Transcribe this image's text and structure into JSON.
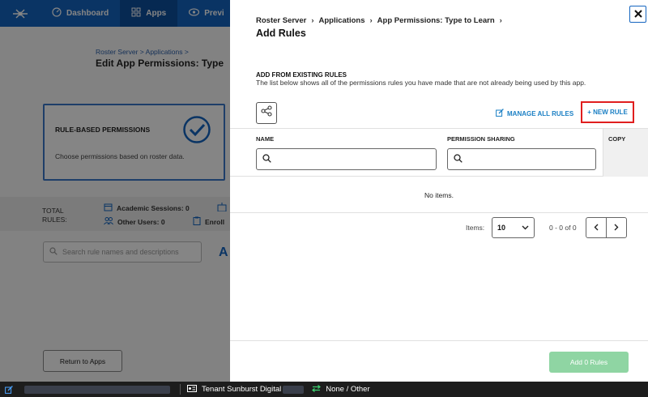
{
  "background": {
    "nav": [
      {
        "label": "Dashboard",
        "icon": "dashboard-icon"
      },
      {
        "label": "Apps",
        "icon": "grid-icon"
      },
      {
        "label": "Previ",
        "icon": "eye-icon"
      }
    ],
    "breadcrumb": [
      "Roster Server",
      "Applications"
    ],
    "title": "Edit App Permissions: Type",
    "card": {
      "title": "RULE-BASED PERMISSIONS",
      "description": "Choose permissions based on roster data."
    },
    "stats": {
      "total_label": "TOTAL RULES:",
      "academic_sessions": "Academic Sessions: 0",
      "other_users": "Other Users: 0",
      "enroll": "Enroll"
    },
    "search_placeholder": "Search rule names and descriptions",
    "big_letter": "A",
    "return_button": "Return to Apps"
  },
  "statusbar": {
    "tenant": "Tenant Sunburst Digital",
    "role": "None / Other"
  },
  "panel": {
    "breadcrumb": [
      "Roster Server",
      "Applications",
      "App Permissions: Type to Learn"
    ],
    "title": "Add Rules",
    "section_title": "ADD FROM EXISTING RULES",
    "section_desc": "The list below shows all of the permissions rules you have made that are not already being used by this app.",
    "manage_link": "MANAGE ALL RULES",
    "new_rule_button": "+ NEW RULE",
    "columns": {
      "name": "NAME",
      "sharing": "PERMISSION SHARING",
      "copy": "COPY"
    },
    "empty_text": "No items.",
    "pager": {
      "items_label": "Items:",
      "page_size": "10",
      "range": "0 - 0 of 0"
    },
    "add_button": "Add 0 Rules"
  },
  "colors": {
    "primary": "#1565c0",
    "link": "#1a7fc4",
    "highlight": "#e01e1e",
    "add_button": "#8fd5a3"
  }
}
